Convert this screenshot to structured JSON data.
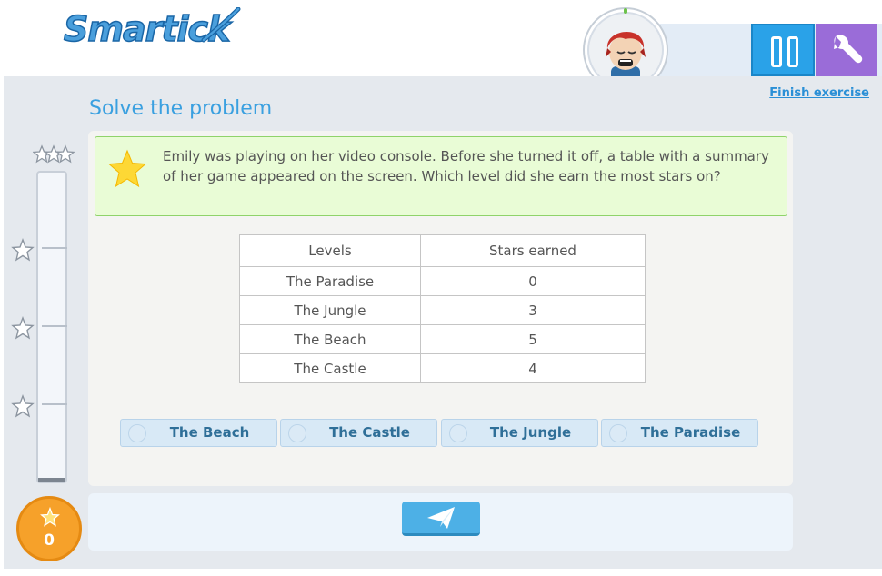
{
  "app": {
    "logo_text": "Smartick",
    "finish_link": "Finish exercise"
  },
  "exercise": {
    "title": "Solve the problem",
    "question": "Emily was playing on her video console. Before she turned it off, a table with a summary of her game appeared on the screen. Which level did she earn the most stars on?"
  },
  "table": {
    "headers": [
      "Levels",
      "Stars earned"
    ],
    "rows": [
      [
        "The Paradise",
        "0"
      ],
      [
        "The Jungle",
        "3"
      ],
      [
        "The Beach",
        "5"
      ],
      [
        "The Castle",
        "4"
      ]
    ]
  },
  "options": [
    "The Beach",
    "The Castle",
    "The Jungle",
    "The Paradise"
  ],
  "score": "0",
  "colors": {
    "accent_blue": "#3aa0e0",
    "pause_blue": "#2aa2e8",
    "settings_purple": "#9a6cd8",
    "score_orange": "#f6a12a",
    "question_bg": "#e9fcd6"
  },
  "icons": {
    "pause": "pause-icon",
    "settings": "wrench-icon",
    "send": "paper-plane-icon",
    "star": "star-icon"
  }
}
